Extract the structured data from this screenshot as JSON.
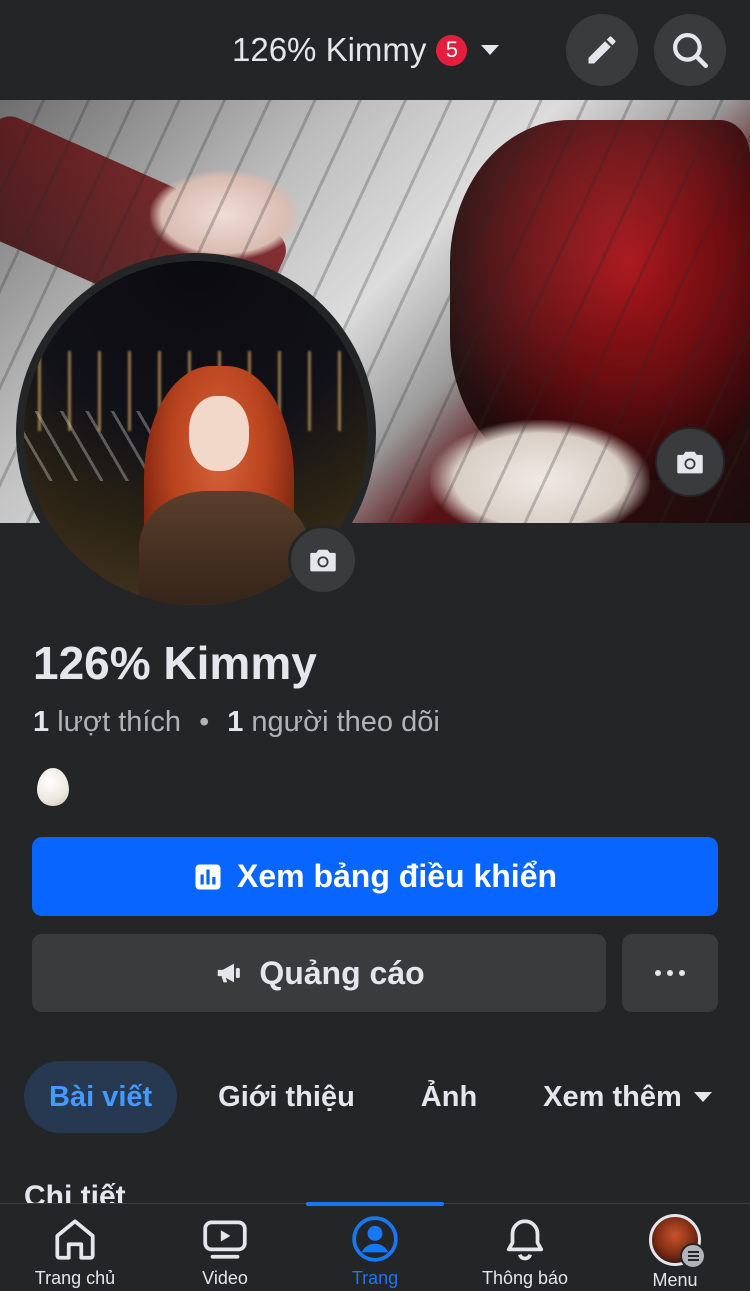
{
  "header": {
    "page_name": "126% Kimmy",
    "notification_count": "5"
  },
  "profile": {
    "name": "126% Kimmy",
    "likes_count": "1",
    "likes_label": "lượt thích",
    "separator": "•",
    "followers_count": "1",
    "followers_label": "người theo dõi",
    "bio_emoji": "egg"
  },
  "actions": {
    "dashboard_label": "Xem bảng điều khiển",
    "advertise_label": "Quảng cáo"
  },
  "tabs": [
    {
      "label": "Bài viết",
      "active": true
    },
    {
      "label": "Giới thiệu",
      "active": false
    },
    {
      "label": "Ảnh",
      "active": false
    },
    {
      "label": "Xem thêm",
      "active": false
    }
  ],
  "section": {
    "heading": "Chi tiết"
  },
  "bottom_nav": [
    {
      "label": "Trang chủ",
      "icon": "home-icon",
      "active": false
    },
    {
      "label": "Video",
      "icon": "video-icon",
      "active": false
    },
    {
      "label": "Trang",
      "icon": "page-profile-icon",
      "active": true
    },
    {
      "label": "Thông báo",
      "icon": "bell-icon",
      "active": false
    },
    {
      "label": "Menu",
      "icon": "menu-avatar",
      "active": false
    }
  ],
  "colors": {
    "background": "#242526",
    "surface": "#3a3b3c",
    "primary": "#0866ff",
    "active_tab_bg": "#263951",
    "active_tab_text": "#4599ff",
    "nav_active": "#1877f2",
    "badge": "#e41e3f"
  }
}
